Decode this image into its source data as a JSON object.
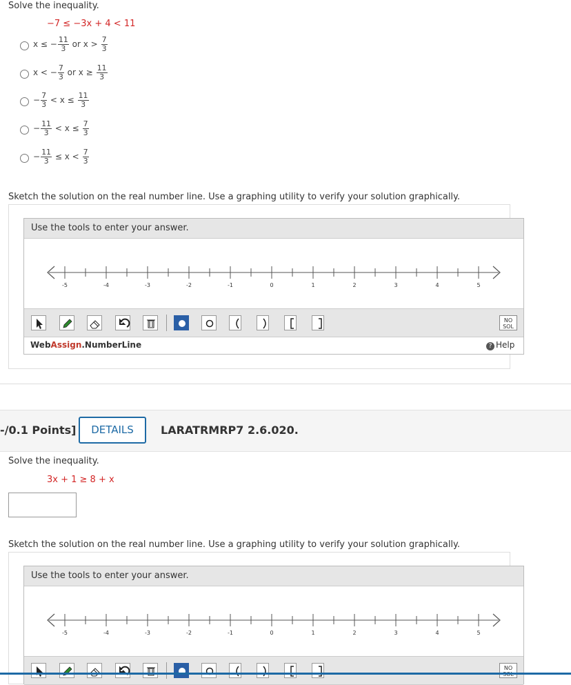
{
  "q1": {
    "prompt": "Solve the inequality.",
    "inequality": {
      "left": "−7 ≤ −3x",
      "plus": "+",
      "four": "4",
      "lt": "<",
      "eleven": "11"
    },
    "options": [
      {
        "pre": "x ≤ −",
        "f1n": "11",
        "f1d": "3",
        "mid": "or x >",
        "f2n": "7",
        "f2d": "3"
      },
      {
        "pre": "x < −",
        "f1n": "7",
        "f1d": "3",
        "mid": "or x ≥",
        "f2n": "11",
        "f2d": "3"
      },
      {
        "pre": "−",
        "f1n": "7",
        "f1d": "3",
        "mid": "< x ≤",
        "f2n": "11",
        "f2d": "3"
      },
      {
        "pre": "−",
        "f1n": "11",
        "f1d": "3",
        "mid": "< x ≤",
        "f2n": "7",
        "f2d": "3"
      },
      {
        "pre": "−",
        "f1n": "11",
        "f1d": "3",
        "mid": "≤ x <",
        "f2n": "7",
        "f2d": "3"
      }
    ],
    "sketch_text": "Sketch the solution on the real number line. Use a graphing utility to verify your solution graphically."
  },
  "numberline": {
    "header": "Use the tools to enter your answer.",
    "ticks": [
      "-5",
      "-4",
      "-3",
      "-2",
      "-1",
      "0",
      "1",
      "2",
      "3",
      "4",
      "5"
    ],
    "tools": [
      "pointer-icon",
      "pencil-icon",
      "eraser-icon",
      "undo-icon",
      "trash-icon",
      "filled-dot-icon",
      "open-dot-icon",
      "open-paren-icon",
      "close-paren-icon",
      "open-bracket-icon",
      "close-bracket-icon"
    ],
    "no_sol_line1": "NO",
    "no_sol_line2": "SOL",
    "brand_web": "Web",
    "brand_assign": "Assign",
    "brand_rest": ".NumberLine",
    "help": "Help",
    "active_color": "#2a5fa6"
  },
  "q2": {
    "points": "-/0.1 Points]",
    "details": "DETAILS",
    "code": "LARATRMRP7 2.6.020.",
    "prompt": "Solve the inequality.",
    "inequality": "3x + 1 ≥ 8 + x",
    "answer_value": "",
    "sketch_text": "Sketch the solution on the real number line. Use a graphing utility to verify your solution graphically."
  },
  "colors": {
    "accent": "#1d6aa5",
    "red": "#d32626"
  }
}
